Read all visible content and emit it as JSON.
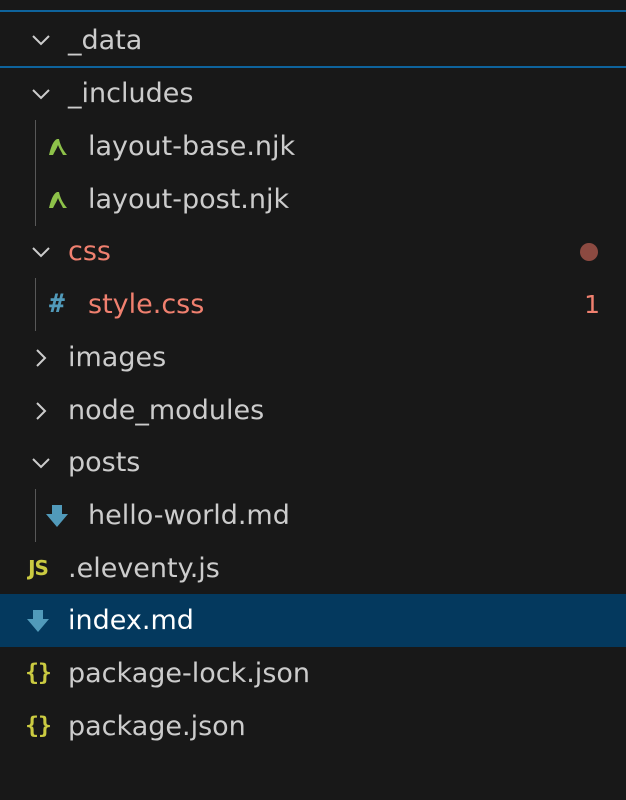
{
  "explorer": {
    "items": [
      {
        "label": "_data",
        "kind": "folder",
        "expanded": true,
        "sticky": true
      },
      {
        "label": "_includes",
        "kind": "folder",
        "expanded": true
      },
      {
        "label": "layout-base.njk",
        "kind": "file",
        "icon": "nunjucks-icon"
      },
      {
        "label": "layout-post.njk",
        "kind": "file",
        "icon": "nunjucks-icon"
      },
      {
        "label": "css",
        "kind": "folder",
        "expanded": true,
        "modified": true
      },
      {
        "label": "style.css",
        "kind": "file",
        "icon": "css-hash-icon",
        "problems": "1"
      },
      {
        "label": "images",
        "kind": "folder",
        "expanded": false
      },
      {
        "label": "node_modules",
        "kind": "folder",
        "expanded": false
      },
      {
        "label": "posts",
        "kind": "folder",
        "expanded": true
      },
      {
        "label": "hello-world.md",
        "kind": "file",
        "icon": "markdown-icon"
      },
      {
        "label": ".eleventy.js",
        "kind": "file",
        "icon": "javascript-icon",
        "icon_text": "JS"
      },
      {
        "label": "index.md",
        "kind": "file",
        "icon": "markdown-icon",
        "selected": true
      },
      {
        "label": "package-lock.json",
        "kind": "file",
        "icon": "json-icon",
        "icon_text": "{}"
      },
      {
        "label": "package.json",
        "kind": "file",
        "icon": "json-icon",
        "icon_text": "{}"
      }
    ]
  },
  "colors": {
    "background": "#181818",
    "text": "#cccccc",
    "selected_background": "#04395e",
    "focus_border": "#0e639c",
    "modified": "#f0806f",
    "nunjucks": "#8dc149",
    "css": "#519aba",
    "markdown": "#519aba",
    "javascript": "#cbcb41",
    "json": "#cbcb41"
  }
}
